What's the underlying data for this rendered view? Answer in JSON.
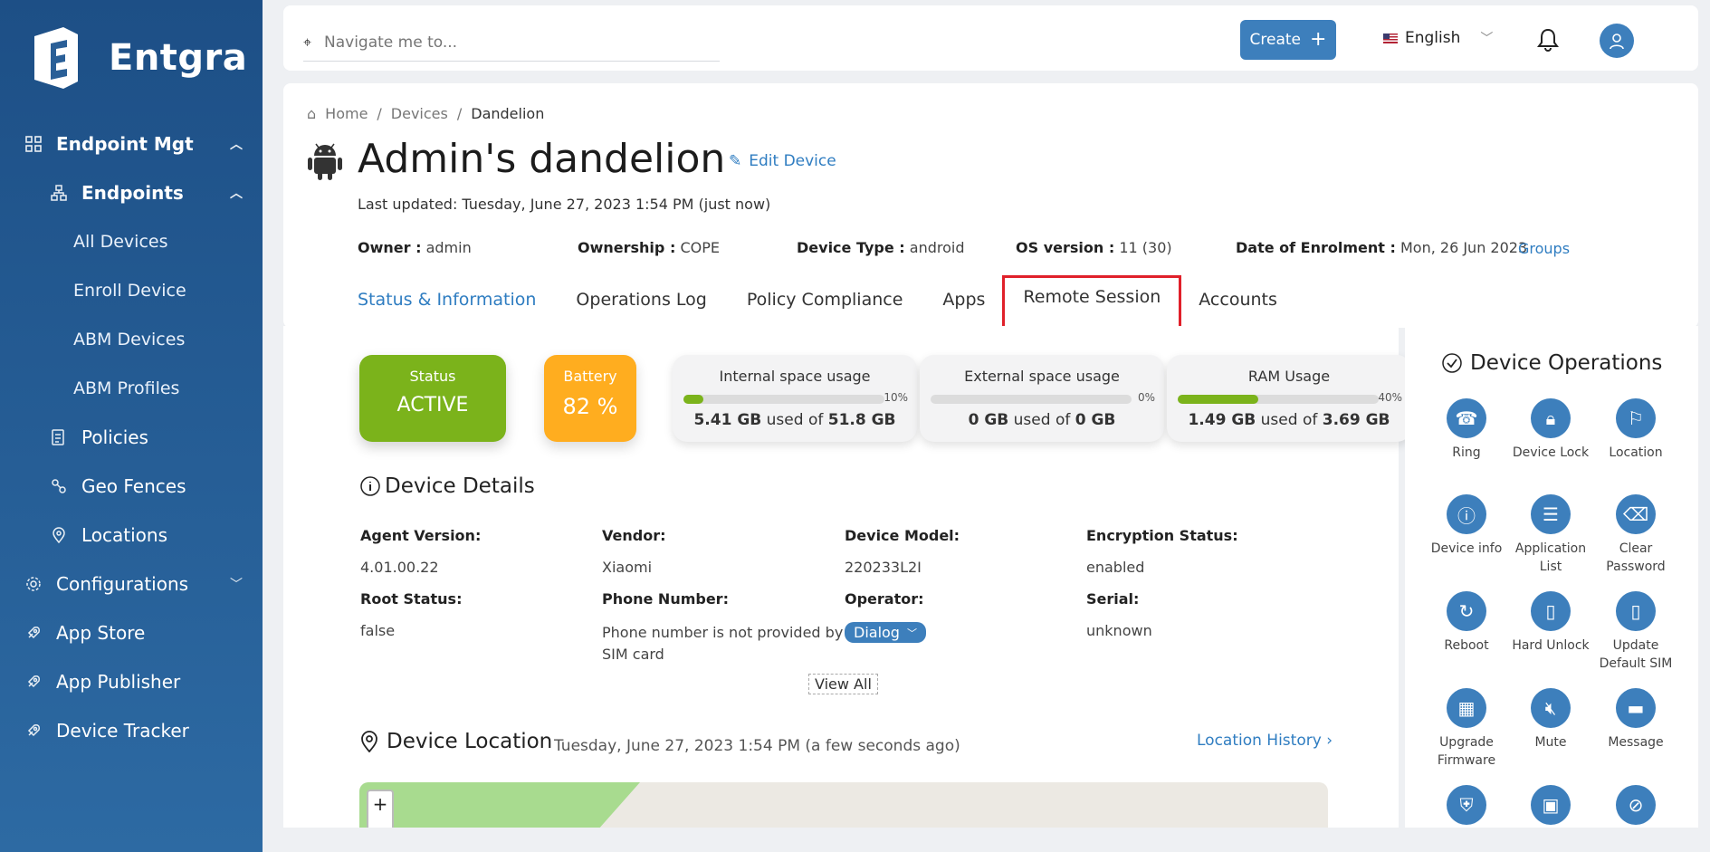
{
  "brand": {
    "name": "Entgra"
  },
  "sidebar": {
    "items": [
      {
        "label": "Endpoint Mgt",
        "icon": "grid-icon",
        "expanded": true
      },
      {
        "label": "Endpoints",
        "icon": "hierarchy-icon",
        "expanded": true
      },
      {
        "label": "All Devices"
      },
      {
        "label": "Enroll Device"
      },
      {
        "label": "ABM Devices"
      },
      {
        "label": "ABM Profiles"
      },
      {
        "label": "Policies",
        "icon": "policy-icon"
      },
      {
        "label": "Geo Fences",
        "icon": "geofence-icon"
      },
      {
        "label": "Locations",
        "icon": "location-pin-icon"
      },
      {
        "label": "Configurations",
        "icon": "gear-icon"
      },
      {
        "label": "App Store",
        "icon": "rocket-icon"
      },
      {
        "label": "App Publisher",
        "icon": "rocket-icon"
      },
      {
        "label": "Device Tracker",
        "icon": "rocket-icon"
      }
    ]
  },
  "topbar": {
    "search_placeholder": "Navigate me to...",
    "create_label": "Create",
    "language": "English"
  },
  "breadcrumb": {
    "home": "Home",
    "devices": "Devices",
    "current": "Dandelion"
  },
  "device": {
    "title": "Admin's dandelion",
    "edit_label": "Edit Device",
    "last_updated": "Last updated: Tuesday, June 27, 2023 1:54 PM (just now)",
    "owner_label": "Owner :",
    "owner": "admin",
    "ownership_label": "Ownership :",
    "ownership": "COPE",
    "type_label": "Device Type :",
    "type": "android",
    "os_label": "OS version :",
    "os": "11 (30)",
    "enrol_label": "Date of Enrolment :",
    "enrol": "Mon, 26 Jun 2023",
    "groups_label": "Groups"
  },
  "tabs": [
    {
      "label": "Status & Information",
      "active": true
    },
    {
      "label": "Operations Log"
    },
    {
      "label": "Policy Compliance"
    },
    {
      "label": "Apps"
    },
    {
      "label": "Remote Session",
      "highlighted": true
    },
    {
      "label": "Accounts"
    }
  ],
  "status": {
    "label": "Status",
    "value": "ACTIVE",
    "color": "#7bb31b"
  },
  "battery": {
    "label": "Battery",
    "value": "82 %",
    "color": "#ffad1f"
  },
  "usage": [
    {
      "label": "Internal space usage",
      "percent": 10,
      "pct_text": "10%",
      "used": "5.41 GB",
      "total": "51.8 GB",
      "mid": " used of "
    },
    {
      "label": "External space usage",
      "percent": 0,
      "pct_text": "0%",
      "used": "0 GB",
      "total": "0 GB",
      "mid": " used of "
    },
    {
      "label": "RAM Usage",
      "percent": 40,
      "pct_text": "40%",
      "used": "1.49 GB",
      "total": "3.69 GB",
      "mid": " used of "
    }
  ],
  "details": {
    "title": "Device Details",
    "agent_version_label": "Agent Version",
    "agent_version": "4.01.00.22",
    "vendor_label": "Vendor",
    "vendor": "Xiaomi",
    "model_label": "Device Model",
    "model": "220233L2I",
    "encryption_label": "Encryption Status",
    "encryption": "enabled",
    "root_label": "Root Status",
    "root": "false",
    "phone_label": "Phone Number",
    "phone": "Phone number is not provided by SIM card",
    "operator_label": "Operator",
    "operator": "Dialog",
    "serial_label": "Serial",
    "serial": "unknown",
    "view_all": "View All"
  },
  "location": {
    "title": "Device Location",
    "time": "Tuesday, June 27, 2023 1:54 PM (a few seconds ago)",
    "history_label": "Location History"
  },
  "operations": {
    "title": "Device Operations",
    "items": [
      {
        "label": "Ring",
        "icon": "phone-icon"
      },
      {
        "label": "Device Lock",
        "icon": "lock-icon"
      },
      {
        "label": "Location",
        "icon": "map-icon"
      },
      {
        "label": "Device info",
        "icon": "info-icon"
      },
      {
        "label": "Application List",
        "icon": "list-icon"
      },
      {
        "label": "Clear Password",
        "icon": "eraser-icon"
      },
      {
        "label": "Reboot",
        "icon": "reboot-icon"
      },
      {
        "label": "Hard Unlock",
        "icon": "mobile-icon"
      },
      {
        "label": "Update Default SIM",
        "icon": "mobile-icon"
      },
      {
        "label": "Upgrade Firmware",
        "icon": "chip-icon"
      },
      {
        "label": "Mute",
        "icon": "mute-icon"
      },
      {
        "label": "Message",
        "icon": "message-icon"
      },
      {
        "label": "",
        "icon": "shield-icon"
      },
      {
        "label": "",
        "icon": "save-icon"
      },
      {
        "label": "",
        "icon": "block-icon"
      }
    ]
  },
  "colors": {
    "accent": "#3d7fbc",
    "sidebar_top": "#1d4f86",
    "highlight_box": "#e0202a"
  }
}
